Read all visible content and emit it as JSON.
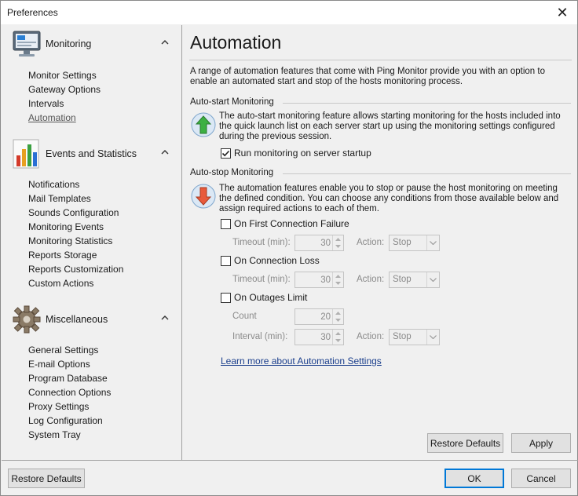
{
  "window": {
    "title": "Preferences"
  },
  "sidebar": {
    "groups": [
      {
        "title": "Monitoring",
        "icon": "monitor-icon",
        "items": [
          "Monitor Settings",
          "Gateway Options",
          "Intervals",
          "Automation"
        ]
      },
      {
        "title": "Events and Statistics",
        "icon": "bar-chart-icon",
        "items": [
          "Notifications",
          "Mail Templates",
          "Sounds Configuration",
          "Monitoring Events",
          "Monitoring Statistics",
          "Reports Storage",
          "Reports Customization",
          "Custom Actions"
        ]
      },
      {
        "title": "Miscellaneous",
        "icon": "gear-icon",
        "items": [
          "General Settings",
          "E-mail Options",
          "Program Database",
          "Connection Options",
          "Proxy Settings",
          "Log Configuration",
          "System Tray"
        ]
      }
    ],
    "active_item": "Automation"
  },
  "main": {
    "title": "Automation",
    "intro": "A range of automation features that come with Ping Monitor provide you with an option to enable an automated start and stop of the hosts monitoring process.",
    "autostart": {
      "heading": "Auto-start Monitoring",
      "description": "The auto-start monitoring feature allows starting monitoring for the hosts included into the quick launch list on each server start up using the monitoring settings configured during the previous session.",
      "checkbox_label": "Run monitoring on server startup",
      "checked": true
    },
    "autostop": {
      "heading": "Auto-stop Monitoring",
      "description": "The automation features enable you to stop or pause the host monitoring on meeting the defined condition. You can choose any conditions from those available below and assign required actions to each of them.",
      "first_failure": {
        "label": "On First Connection Failure",
        "checked": false,
        "timeout_label": "Timeout (min):",
        "timeout_value": "30",
        "action_label": "Action:",
        "action_value": "Stop"
      },
      "connection_loss": {
        "label": "On Connection Loss",
        "checked": false,
        "timeout_label": "Timeout (min):",
        "timeout_value": "30",
        "action_label": "Action:",
        "action_value": "Stop"
      },
      "outages_limit": {
        "label": "On Outages Limit",
        "checked": false,
        "count_label": "Count",
        "count_value": "20",
        "interval_label": "Interval (min):",
        "interval_value": "30",
        "action_label": "Action:",
        "action_value": "Stop"
      }
    },
    "learn_more": "Learn more about Automation Settings",
    "restore_defaults": "Restore Defaults",
    "apply": "Apply"
  },
  "footer": {
    "restore_defaults": "Restore Defaults",
    "ok": "OK",
    "cancel": "Cancel"
  },
  "colors": {
    "link": "#1a3e8c",
    "primary_border": "#0078d7",
    "up_arrow": "#3cb043",
    "down_arrow": "#e85a3c"
  }
}
